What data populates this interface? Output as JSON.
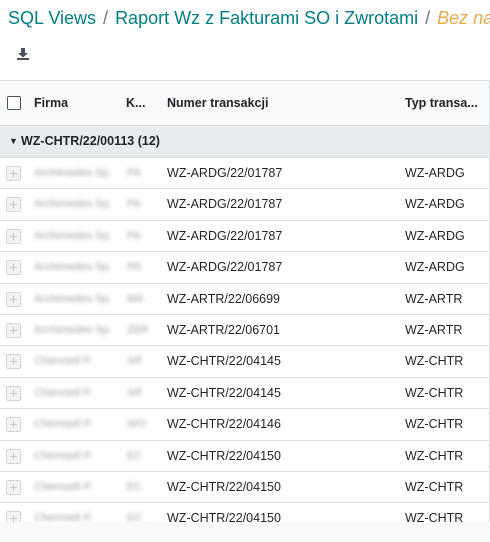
{
  "breadcrumb": {
    "items": [
      "SQL Views",
      "Raport Wz z Fakturami SO i Zwrotami"
    ],
    "separator": "/",
    "active": "Bez naz"
  },
  "toolbar": {
    "download_icon": "download-icon"
  },
  "table": {
    "columns": [
      "Firma",
      "K...",
      "Numer transakcji",
      "Typ transa..."
    ],
    "group": {
      "label": "WZ-CHTR/22/00113 (12)"
    },
    "rows": [
      {
        "firma": "Archimedes Sp.",
        "k": "PA",
        "numer": "WZ-ARDG/22/01787",
        "typ": "WZ-ARDG"
      },
      {
        "firma": "Archimedes Sp.",
        "k": "PA",
        "numer": "WZ-ARDG/22/01787",
        "typ": "WZ-ARDG"
      },
      {
        "firma": "Archimedes Sp.",
        "k": "PA",
        "numer": "WZ-ARDG/22/01787",
        "typ": "WZ-ARDG"
      },
      {
        "firma": "Archimedes Sp.",
        "k": "PA",
        "numer": "WZ-ARDG/22/01787",
        "typ": "WZ-ARDG"
      },
      {
        "firma": "Archimedes Sp.",
        "k": "MA",
        "numer": "WZ-ARTR/22/06699",
        "typ": "WZ-ARTR"
      },
      {
        "firma": "Archimedes Sp.",
        "k": "ZER",
        "numer": "WZ-ARTR/22/06701",
        "typ": "WZ-ARTR"
      },
      {
        "firma": "Chemsetl P.",
        "k": "AR",
        "numer": "WZ-CHTR/22/04145",
        "typ": "WZ-CHTR"
      },
      {
        "firma": "Chemsetl P.",
        "k": "AR",
        "numer": "WZ-CHTR/22/04145",
        "typ": "WZ-CHTR"
      },
      {
        "firma": "Chemsetl P.",
        "k": "WO",
        "numer": "WZ-CHTR/22/04146",
        "typ": "WZ-CHTR"
      },
      {
        "firma": "Chemsetl P.",
        "k": "EC",
        "numer": "WZ-CHTR/22/04150",
        "typ": "WZ-CHTR"
      },
      {
        "firma": "Chemsetl P.",
        "k": "EC",
        "numer": "WZ-CHTR/22/04150",
        "typ": "WZ-CHTR"
      },
      {
        "firma": "Chemsetl P.",
        "k": "EC",
        "numer": "WZ-CHTR/22/04150",
        "typ": "WZ-CHTR"
      }
    ]
  }
}
